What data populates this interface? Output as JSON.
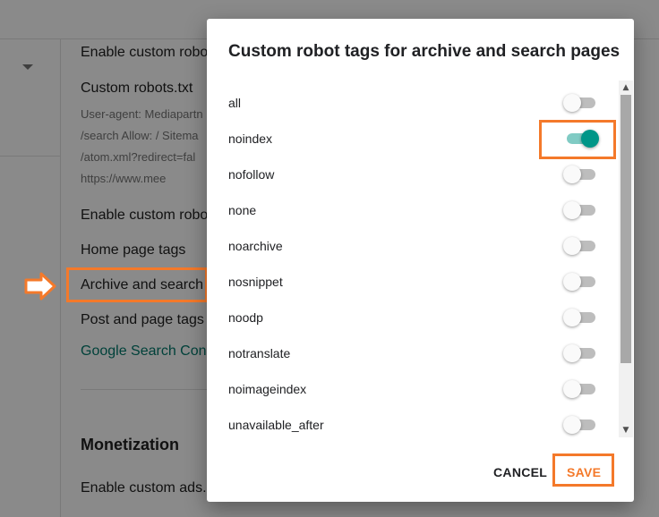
{
  "background": {
    "items": [
      "Enable custom robo",
      "Custom robots.txt",
      "Enable custom robo",
      "Home page tags",
      "Archive and search",
      "Post and page tags",
      "Google Search Cons"
    ],
    "robots_preview": [
      "User-agent: Mediapartn",
      "/search Allow: / Sitema",
      "/atom.xml?redirect=fal",
      "https://www.mee"
    ],
    "section_heading": "Monetization",
    "last_item": "Enable custom ads."
  },
  "dialog": {
    "title": "Custom robot tags for archive and search pages",
    "tags": [
      {
        "label": "all",
        "enabled": false
      },
      {
        "label": "noindex",
        "enabled": true
      },
      {
        "label": "nofollow",
        "enabled": false
      },
      {
        "label": "none",
        "enabled": false
      },
      {
        "label": "noarchive",
        "enabled": false
      },
      {
        "label": "nosnippet",
        "enabled": false
      },
      {
        "label": "noodp",
        "enabled": false
      },
      {
        "label": "notranslate",
        "enabled": false
      },
      {
        "label": "noimageindex",
        "enabled": false
      },
      {
        "label": "unavailable_after",
        "enabled": false
      }
    ],
    "cancel_label": "CANCEL",
    "save_label": "SAVE"
  },
  "colors": {
    "highlight": "#f4792a",
    "toggle_on": "#009688",
    "link": "#00796b"
  },
  "icons": {
    "scroll_up": "▲",
    "scroll_down": "▼"
  }
}
